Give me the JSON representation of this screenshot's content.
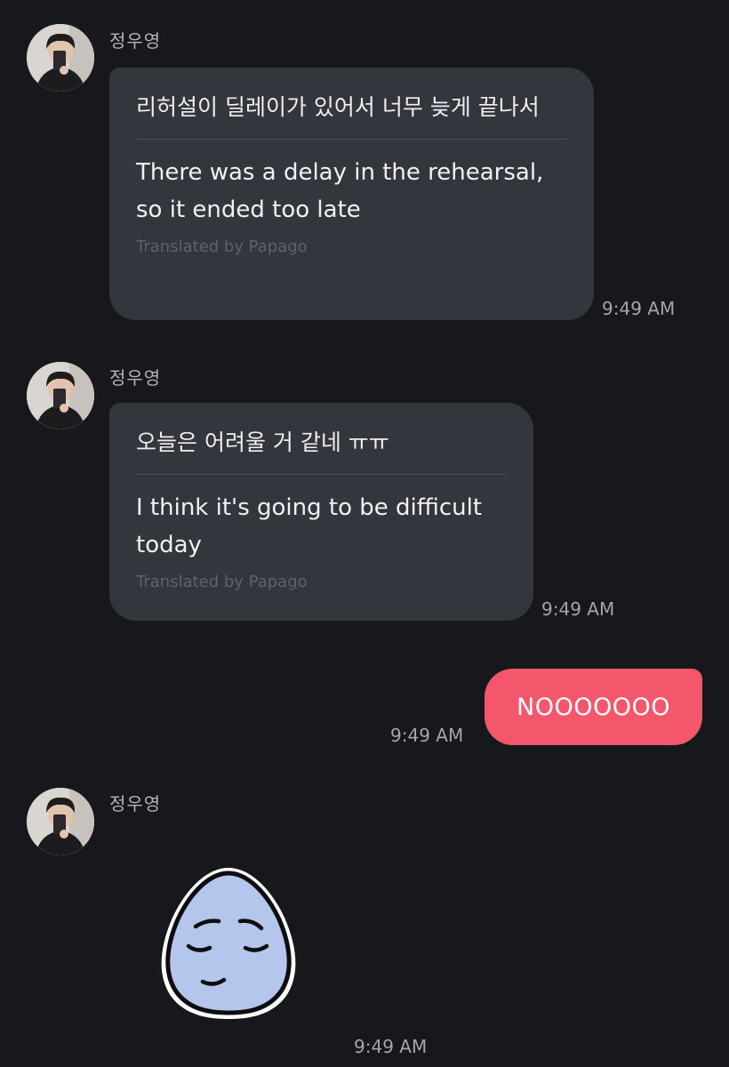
{
  "messages": [
    {
      "sender": "정우영",
      "original": "리허설이 딜레이가 있어서 너무 늦게 끝나서",
      "translation": "There was a delay in the rehearsal, so it ended too late",
      "credit": "Translated by Papago",
      "time": "9:49 AM"
    },
    {
      "sender": "정우영",
      "original": "오늘은 어려울 거 같네 ㅠㅠ",
      "translation": "I think it's going to be difficult today",
      "credit": "Translated by Papago",
      "time": "9:49 AM"
    },
    {
      "text": "NOOOOOOO",
      "time": "9:49 AM"
    },
    {
      "sender": "정우영",
      "sticker": "sad-face-sticker-icon",
      "time": "9:49 AM"
    }
  ],
  "colors": {
    "background": "#17181c",
    "incoming_bubble": "#34363d",
    "outgoing_bubble": "#f4566b",
    "sticker_fill": "#b4c6ec"
  }
}
